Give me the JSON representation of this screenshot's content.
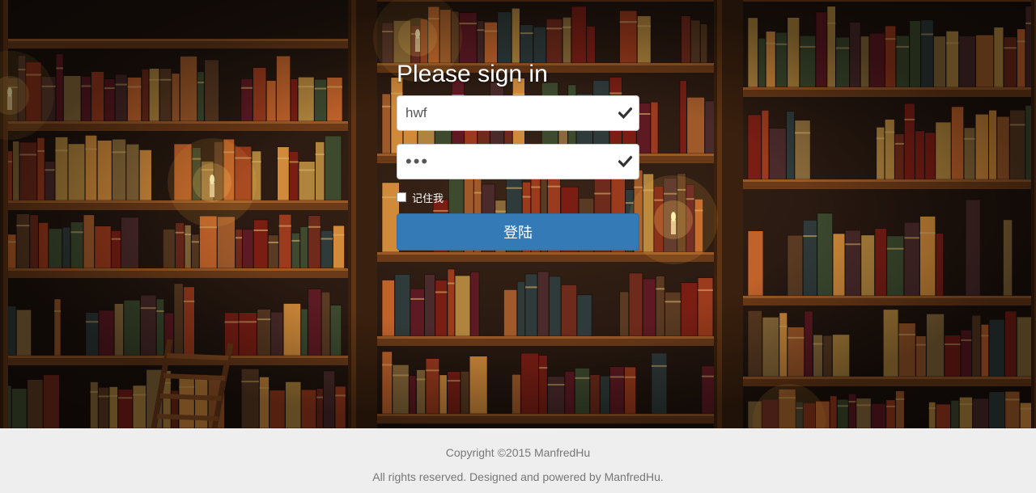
{
  "signin": {
    "title": "Please sign in",
    "username_value": "hwf",
    "password_value": "•••",
    "remember_label": "记住我",
    "remember_checked": false,
    "submit_label": "登陆",
    "field_status_icon": "check-icon"
  },
  "footer": {
    "copyright": "Copyright ©2015 ManfredHu",
    "rights": "All rights reserved. Designed and powered by ManfredHu."
  },
  "colors": {
    "primary_button": "#337ab7",
    "footer_bg": "#eeeeee",
    "footer_text": "#777777"
  }
}
